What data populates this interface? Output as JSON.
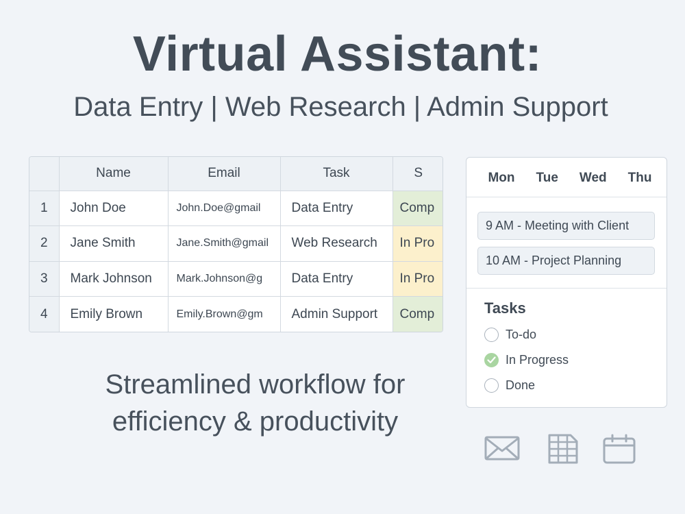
{
  "header": {
    "title": "Virtual Assistant:",
    "subtitle": "Data Entry | Web Research | Admin Support"
  },
  "spreadsheet": {
    "columns": [
      "",
      "Name",
      "Email",
      "Task",
      "S"
    ],
    "rows": [
      {
        "num": "1",
        "name": "John Doe",
        "email": "John.Doe@gmail",
        "task": "Data Entry",
        "status": "Comp",
        "status_type": "complete"
      },
      {
        "num": "2",
        "name": "Jane Smith",
        "email": "Jane.Smith@gmail",
        "task": "Web Research",
        "status": "In Pro",
        "status_type": "progress"
      },
      {
        "num": "3",
        "name": "Mark Johnson",
        "email": "Mark.Johnson@g",
        "task": "Data Entry",
        "status": "In Pro",
        "status_type": "progress"
      },
      {
        "num": "4",
        "name": "Emily Brown",
        "email": "Emily.Brown@gm",
        "task": "Admin Support",
        "status": "Comp",
        "status_type": "complete"
      }
    ]
  },
  "calendar": {
    "days": [
      "Mon",
      "Tue",
      "Wed",
      "Thu"
    ],
    "events": [
      "9 AM - Meeting with Client",
      "10 AM - Project Planning"
    ]
  },
  "tasks": {
    "heading": "Tasks",
    "items": [
      {
        "label": "To-do",
        "checked": false
      },
      {
        "label": "In Progress",
        "checked": true
      },
      {
        "label": "Done",
        "checked": false
      }
    ]
  },
  "tagline": {
    "line1": "Streamlined workflow for",
    "line2": "efficiency & productivity"
  },
  "icons": [
    "mail-icon",
    "spreadsheet-icon",
    "calendar-icon"
  ],
  "colors": {
    "status_complete": "#e3eed8",
    "status_progress": "#fcf0cc",
    "check_green": "#a9d5a1"
  }
}
